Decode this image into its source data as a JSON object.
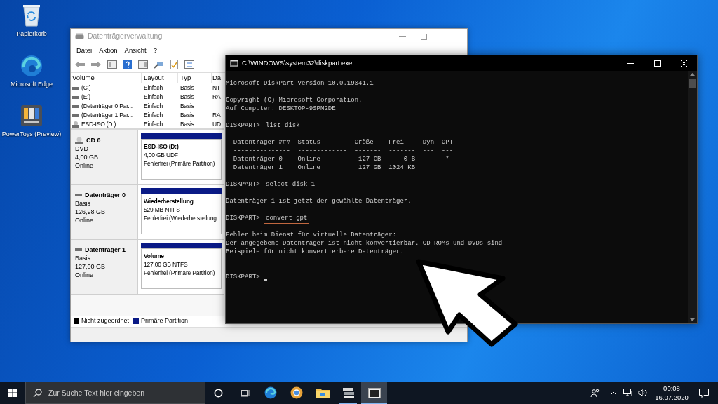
{
  "desktop_icons": [
    {
      "kind": "recycle-bin",
      "label": "Papierkorb"
    },
    {
      "kind": "browser",
      "label": "Microsoft Edge"
    },
    {
      "kind": "app-tiles",
      "label": "PowerToys (Preview)"
    }
  ],
  "disk_management": {
    "title": "Datenträgerverwaltung",
    "active": false,
    "menu": [
      "Datei",
      "Aktion",
      "Ansicht",
      "?"
    ],
    "table": {
      "columns": [
        "Volume",
        "Layout",
        "Typ",
        "Da"
      ],
      "rows": [
        {
          "kind": "disk",
          "cells": [
            "(C:)",
            "Einfach",
            "Basis",
            "NT"
          ]
        },
        {
          "kind": "disk",
          "cells": [
            "(E:)",
            "Einfach",
            "Basis",
            "RA"
          ]
        },
        {
          "kind": "disk",
          "cells": [
            "(Datenträger 0 Par...",
            "Einfach",
            "Basis"
          ]
        },
        {
          "kind": "disk",
          "cells": [
            "(Datenträger 1 Par...",
            "Einfach",
            "Basis",
            "RA"
          ]
        },
        {
          "kind": "optical",
          "cells": [
            "ESD-ISO (D:)",
            "Einfach",
            "Basis",
            "UD"
          ]
        }
      ]
    },
    "disks": [
      {
        "kind": "optical",
        "name": "CD 0",
        "details": [
          "DVD",
          "4,00 GB",
          "Online"
        ],
        "partition": {
          "name": "ESD-ISO  (D:)",
          "size": "4,00 GB UDF",
          "status": "Fehlerfrei (Primäre Partition)",
          "color": "#0a1a86"
        }
      },
      {
        "kind": "disk",
        "name": "Datenträger 0",
        "details": [
          "Basis",
          "126,98 GB",
          "Online"
        ],
        "partition": {
          "name": "Wiederherstellung",
          "size": "529 MB NTFS",
          "status": "Fehlerfrei (Wiederherstellung",
          "color": "#0a1a86"
        }
      },
      {
        "kind": "disk",
        "name": "Datenträger 1",
        "details": [
          "Basis",
          "127,00 GB",
          "Online"
        ],
        "partition": {
          "name": "Volume",
          "size": "127,00 GB NTFS",
          "status": "Fehlerfrei (Primäre Partition)",
          "color": "#0a1a86"
        }
      }
    ],
    "legend": [
      {
        "label": "Nicht zugeordnet",
        "color": "#000000"
      },
      {
        "label": "Primäre Partition",
        "color": "#0a1a86"
      }
    ]
  },
  "console": {
    "title": "C:\\WINDOWS\\system32\\diskpart.exe",
    "active": true,
    "lines": [
      {
        "kind": "output",
        "text": "Microsoft DiskPart-Version 10.0.19041.1"
      },
      {
        "kind": "blank"
      },
      {
        "kind": "output",
        "text": "Copyright (C) Microsoft Corporation."
      },
      {
        "kind": "output",
        "text": "Auf Computer: DESKTOP-9SPM2DE"
      },
      {
        "kind": "blank"
      },
      {
        "kind": "command",
        "prompt": "DISKPART>",
        "command": "list disk",
        "highlighted": false
      },
      {
        "kind": "blank"
      },
      {
        "kind": "output",
        "text": "  Datenträger ###  Status         Größe    Frei     Dyn  GPT"
      },
      {
        "kind": "output",
        "text": "  ---------------  -------------  -------  -------  ---  ---"
      },
      {
        "kind": "output",
        "text": "  Datenträger 0    Online          127 GB      0 B        *"
      },
      {
        "kind": "output",
        "text": "  Datenträger 1    Online          127 GB  1024 KB"
      },
      {
        "kind": "blank"
      },
      {
        "kind": "command",
        "prompt": "DISKPART>",
        "command": "select disk 1",
        "highlighted": false
      },
      {
        "kind": "blank"
      },
      {
        "kind": "output",
        "text": "Datenträger 1 ist jetzt der gewählte Datenträger."
      },
      {
        "kind": "blank"
      },
      {
        "kind": "command",
        "prompt": "DISKPART>",
        "command": "convert gpt",
        "highlighted": true
      },
      {
        "kind": "blank"
      },
      {
        "kind": "output",
        "text": "Fehler beim Dienst für virtuelle Datenträger:"
      },
      {
        "kind": "output",
        "text": "Der angegebene Datenträger ist nicht konvertierbar. CD-ROMs und DVDs sind"
      },
      {
        "kind": "output",
        "text": "Beispiele für nicht konvertierbare Datenträger."
      },
      {
        "kind": "blank"
      },
      {
        "kind": "blank"
      },
      {
        "kind": "prompt",
        "prompt": "DISKPART>",
        "cursor": true
      }
    ]
  },
  "taskbar": {
    "search": {
      "placeholder": "Zur Suche Text hier eingeben"
    },
    "apps": [
      {
        "kind": "browser",
        "running": false,
        "selected": false
      },
      {
        "kind": "round-browser",
        "running": false,
        "selected": false
      },
      {
        "kind": "folder",
        "running": false,
        "selected": false
      },
      {
        "kind": "drive-stack",
        "running": true,
        "selected": false
      },
      {
        "kind": "console-window",
        "running": true,
        "selected": true
      }
    ],
    "clock": {
      "time": "00:08",
      "date": "16.07.2020"
    }
  }
}
